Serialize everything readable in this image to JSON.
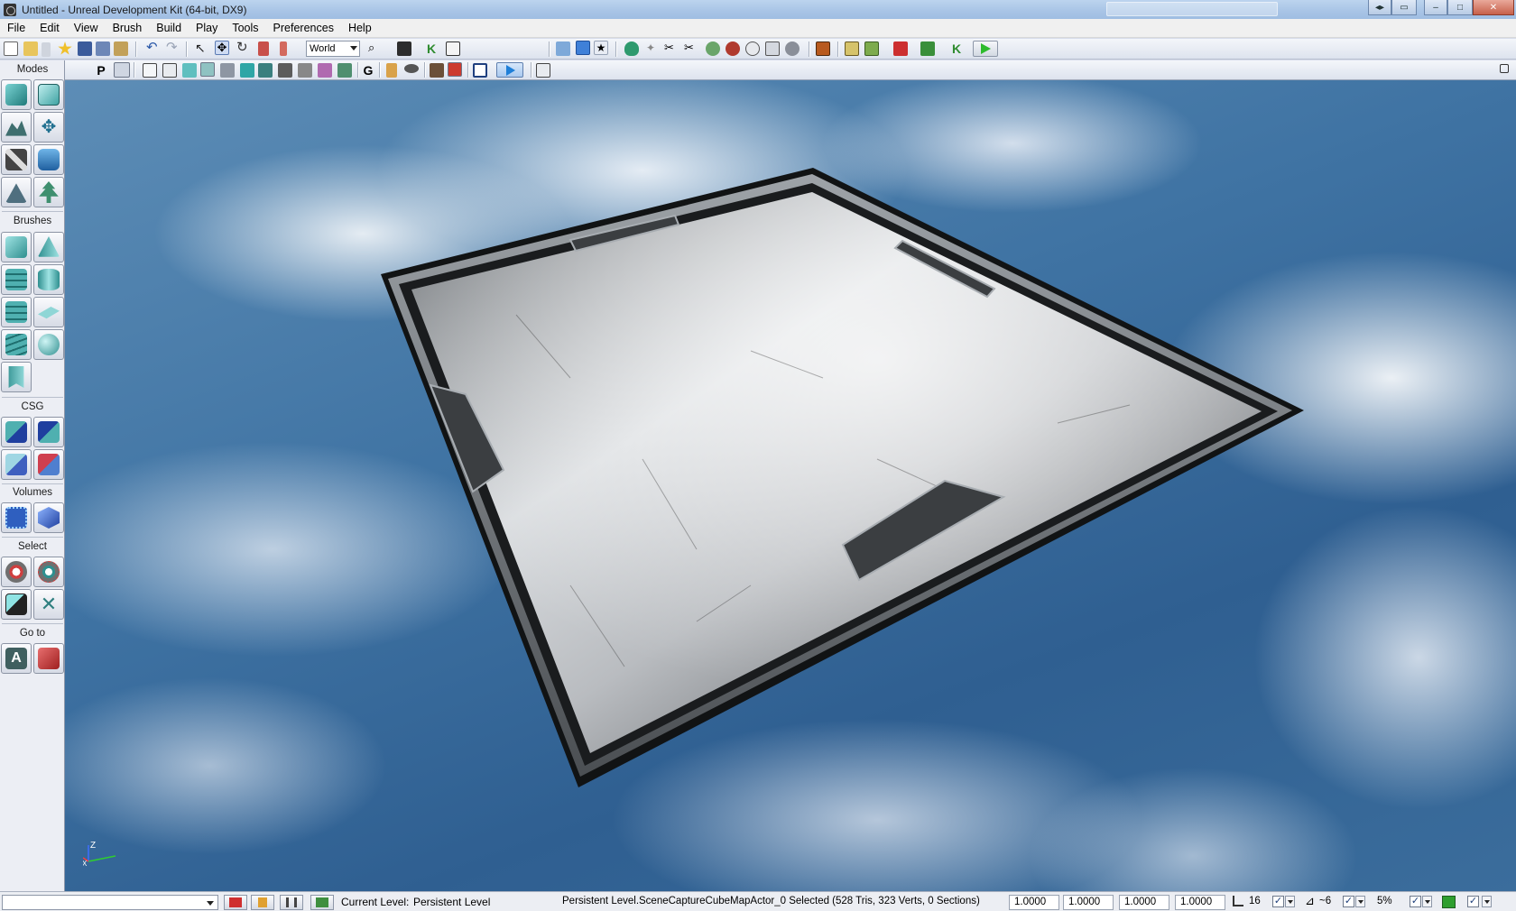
{
  "window": {
    "title": "Untitled - Unreal Development Kit (64-bit, DX9)",
    "buttons": [
      "restore-arrows",
      "restore-small",
      "minimize",
      "maximize",
      "close"
    ]
  },
  "menu": [
    "File",
    "Edit",
    "View",
    "Brush",
    "Build",
    "Play",
    "Tools",
    "Preferences",
    "Help"
  ],
  "toolbar": {
    "coordinate_system": "World",
    "letter_buttons": [
      "K",
      "K"
    ],
    "viewport_toolbar_letters": [
      "P",
      "G"
    ]
  },
  "modes_panel": {
    "sections": [
      {
        "label": "Modes",
        "icons": [
          "camera-mode-icon",
          "geometry-mode-icon",
          "terrain-mode-icon",
          "translate-mode-icon",
          "texture-paint-icon",
          "mesh-paint-icon",
          "landscape-icon",
          "foliage-icon"
        ]
      },
      {
        "label": "Brushes",
        "icons": [
          "cube-brush-icon",
          "cone-brush-icon",
          "curved-stair-brush-icon",
          "cylinder-brush-icon",
          "linear-stair-brush-icon",
          "sheet-brush-icon",
          "spiral-stair-brush-icon",
          "sphere-brush-icon",
          "volumetric-brush-icon"
        ]
      },
      {
        "label": "CSG",
        "icons": [
          "csg-add-icon",
          "csg-subtract-icon",
          "csg-intersect-icon",
          "csg-deintersect-icon"
        ]
      },
      {
        "label": "Volumes",
        "icons": [
          "add-volume-icon",
          "volume-list-icon"
        ]
      },
      {
        "label": "Select",
        "icons": [
          "show-selected-icon",
          "hide-selected-icon",
          "select-all-icon",
          "invert-selection-icon"
        ]
      },
      {
        "label": "Go to",
        "icons": [
          "goto-actor-icon",
          "goto-builder-brush-icon"
        ]
      }
    ]
  },
  "statusbar": {
    "current_level_label": "Current Level:",
    "current_level_value": "Persistent Level",
    "selection_info": "Persistent Level.SceneCaptureCubeMapActor_0 Selected (528 Tris, 323 Verts, 0 Sections)",
    "drag_grid": [
      "1.0000",
      "1.0000",
      "1.0000",
      "1.0000"
    ],
    "grid_size": "16",
    "rotation_snap": "~6",
    "scale_snap": "5%",
    "checkbox_mark": "✓"
  },
  "colors": {
    "title_bar": "#a8c4e6",
    "close_button": "#c7604a",
    "panel_bg": "#eceef4",
    "sky": "#3f73a3",
    "play_green": "#2dbb2d"
  },
  "viewport": {
    "axis_labels": [
      "Z",
      "X",
      "Y"
    ]
  }
}
